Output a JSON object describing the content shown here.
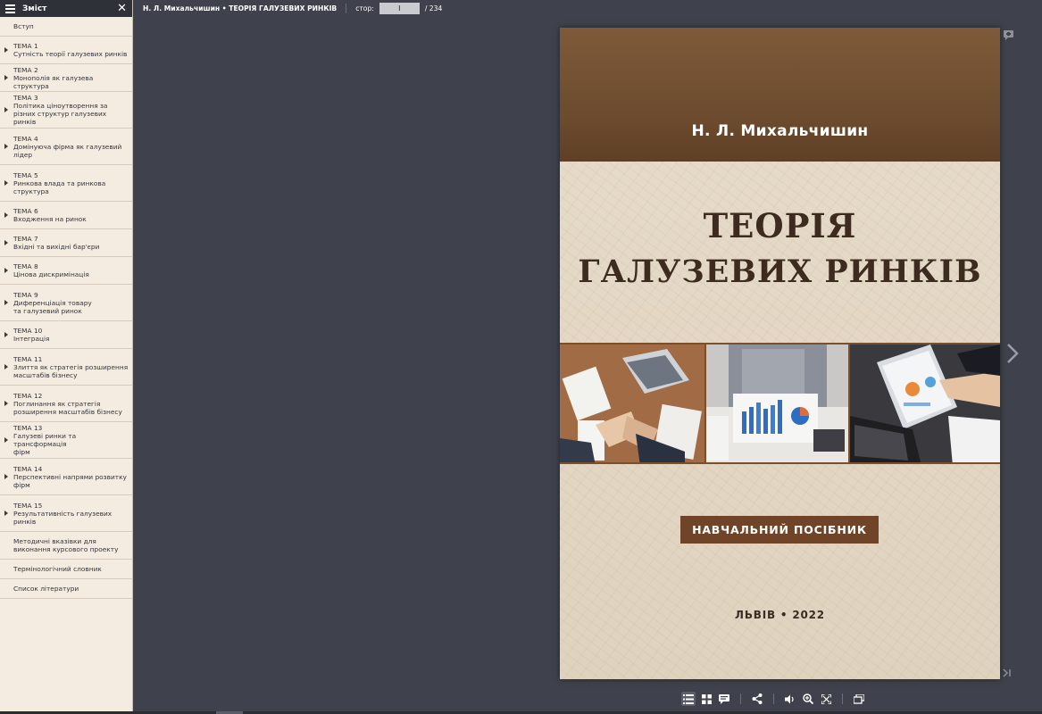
{
  "sidebar": {
    "title": "Зміст",
    "items": [
      {
        "label": "Вступ",
        "has_children": false
      },
      {
        "label": "ТЕМА 1",
        "sub": "Сутність теорії галузевих ринків",
        "has_children": true
      },
      {
        "label": "ТЕМА 2",
        "sub": "Монополія як галузева структура",
        "has_children": true
      },
      {
        "label": "ТЕМА 3",
        "sub": "Політика ціноутворення за",
        "sub2": "різних структур галузевих ринків",
        "has_children": true
      },
      {
        "label": "ТЕМА 4",
        "sub": "Домінуюча фірма як галузевий",
        "sub2": "лідер",
        "has_children": true
      },
      {
        "label": "ТЕМА 5",
        "sub": "Ринкова влада та ринкова",
        "sub2": "структура",
        "has_children": true
      },
      {
        "label": "ТЕМА 6",
        "sub": "Входження на ринок",
        "has_children": true
      },
      {
        "label": "ТЕМА 7",
        "sub": "Вхідні та вихідні бар'єри",
        "has_children": true
      },
      {
        "label": "ТЕМА 8",
        "sub": "Цінова дискримінація",
        "has_children": true
      },
      {
        "label": "ТЕМА 9",
        "sub": "Диференціація товару",
        "sub2": "та галузевий ринок",
        "has_children": true
      },
      {
        "label": "ТЕМА 10",
        "sub": "Інтеграція",
        "has_children": true
      },
      {
        "label": "ТЕМА 11",
        "sub": "Злиття як стратегія розширення",
        "sub2": "масштабів бізнесу",
        "has_children": true
      },
      {
        "label": "ТЕМА 12",
        "sub": "Поглинання як стратегія",
        "sub2": "розширення масштабів бізнесу",
        "has_children": true
      },
      {
        "label": "ТЕМА 13",
        "sub": "Галузеві ринки та трансформація",
        "sub2": "фірм",
        "has_children": true
      },
      {
        "label": "ТЕМА 14",
        "sub": "Перспективні напрями розвитку",
        "sub2": "фірм",
        "has_children": true
      },
      {
        "label": "ТЕМА 15",
        "sub": "Результативність галузевих",
        "sub2": "ринків",
        "has_children": true
      },
      {
        "label": "Методичні вказівки для",
        "sub": "виконання курсового проекту",
        "has_children": false
      },
      {
        "label": "Термінологічний словник",
        "has_children": false
      },
      {
        "label": "Список літератури",
        "has_children": false
      }
    ]
  },
  "topbar": {
    "book_title": "Н. Л. Михальчишин • ТЕОРІЯ ГАЛУЗЕВИХ РИНКІВ",
    "page_label": "стор:",
    "page_value": "I",
    "total_pages": "/ 234"
  },
  "cover": {
    "author": "Н. Л. Михальчишин",
    "title_line1": "ТЕОРІЯ",
    "title_line2": "ГАЛУЗЕВИХ РИНКІВ",
    "subtitle": "НАВЧАЛЬНИЙ ПОСІБНИК",
    "city_year": "ЛЬВІВ • 2022"
  },
  "toolbar": {
    "icons": [
      "list-icon",
      "grid-icon",
      "comment-icon",
      "share-icon",
      "volume-icon",
      "zoom-in-icon",
      "fullscreen-icon",
      "copy-page-icon"
    ]
  },
  "colors": {
    "background": "#3f424c",
    "sidebar_bg": "#f5ece1",
    "cover_brown": "#6b4a2d",
    "subtitle_box": "#6f4428"
  }
}
